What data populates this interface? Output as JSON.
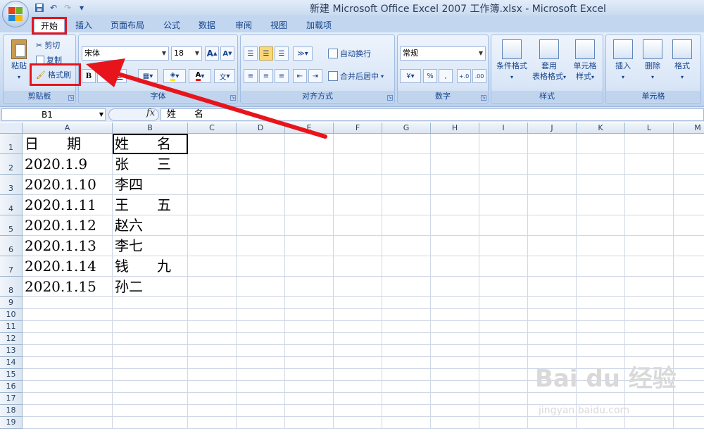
{
  "window": {
    "title": "新建 Microsoft Office Excel 2007 工作簿.xlsx - Microsoft Excel"
  },
  "quick_access": {
    "save": "save-icon",
    "undo": "undo-icon",
    "redo": "redo-icon",
    "customize": "▾"
  },
  "ribbon_tabs": [
    "开始",
    "插入",
    "页面布局",
    "公式",
    "数据",
    "审阅",
    "视图",
    "加载项"
  ],
  "active_tab": "开始",
  "clipboard": {
    "paste": "粘贴",
    "cut": "剪切",
    "copy": "复制",
    "format_painter": "格式刷",
    "label": "剪贴板"
  },
  "font": {
    "name": "宋体",
    "size": "18",
    "grow": "A",
    "shrink": "A",
    "bold": "B",
    "italic": "I",
    "underline": "U",
    "wen": "文",
    "label": "字体"
  },
  "alignment": {
    "wrap": "自动换行",
    "merge": "合并后居中",
    "label": "对齐方式"
  },
  "number": {
    "format": "常规",
    "percent": "%",
    "comma": ",",
    "inc": "+.0",
    "dec": ".00",
    "label": "数字"
  },
  "styles": {
    "conditional": "条件格式",
    "table_line1": "套用",
    "table_line2": "表格格式",
    "cell_line1": "单元格",
    "cell_line2": "样式",
    "label": "样式"
  },
  "cells": {
    "insert": "插入",
    "delete": "删除",
    "format": "格式",
    "label": "单元格"
  },
  "formula_bar": {
    "name_box": "B1",
    "fx": "fx",
    "content": "姓　　名"
  },
  "columns": [
    "A",
    "B",
    "C",
    "D",
    "E",
    "F",
    "G",
    "H",
    "I",
    "J",
    "K",
    "L",
    "M"
  ],
  "rows": [
    "1",
    "2",
    "3",
    "4",
    "5",
    "6",
    "7",
    "8",
    "9",
    "10",
    "11",
    "12",
    "13",
    "14",
    "15",
    "16",
    "17",
    "18",
    "19"
  ],
  "sheet": [
    [
      "日　　期",
      "姓　　名"
    ],
    [
      "2020.1.9",
      "张　　三"
    ],
    [
      "2020.1.10",
      "李四"
    ],
    [
      "2020.1.11",
      "王　　五"
    ],
    [
      "2020.1.12",
      "赵六"
    ],
    [
      "2020.1.13",
      "李七"
    ],
    [
      "2020.1.14",
      "钱　　九"
    ],
    [
      "2020.1.15",
      "孙二"
    ]
  ],
  "watermark": {
    "text": "Bai du 经验",
    "sub": "jingyan.baidu.com"
  },
  "colors": {
    "highlight": "#e8141b",
    "ribbon": "#c8dbf2",
    "grid_line": "#d0d7e5"
  }
}
